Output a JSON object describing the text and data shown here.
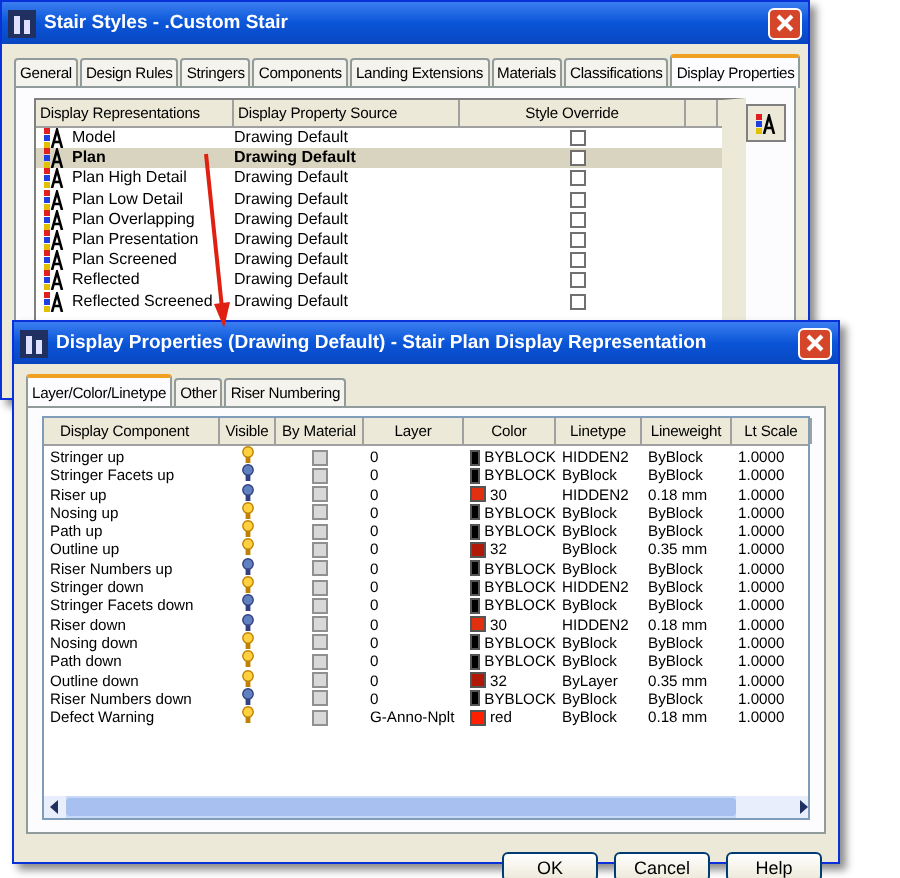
{
  "back_window": {
    "title": "Stair Styles - .Custom Stair",
    "tabs": [
      {
        "label": "General",
        "selected": false
      },
      {
        "label": "Design Rules",
        "selected": false
      },
      {
        "label": "Stringers",
        "selected": false
      },
      {
        "label": "Components",
        "selected": false
      },
      {
        "label": "Landing Extensions",
        "selected": false
      },
      {
        "label": "Materials",
        "selected": false
      },
      {
        "label": "Classifications",
        "selected": false
      },
      {
        "label": "Display Properties",
        "selected": true
      }
    ],
    "columns": [
      "Display Representations",
      "Display Property Source",
      "Style Override"
    ],
    "rows": [
      {
        "name": "Model",
        "source": "Drawing Default",
        "override": false,
        "selected": false
      },
      {
        "name": "Plan",
        "source": "Drawing Default",
        "override": false,
        "selected": true
      },
      {
        "name": "Plan High Detail",
        "source": "Drawing Default",
        "override": false,
        "selected": false
      },
      {
        "name": "Plan Low Detail",
        "source": "Drawing Default",
        "override": false,
        "selected": false
      },
      {
        "name": "Plan Overlapping",
        "source": "Drawing Default",
        "override": false,
        "selected": false
      },
      {
        "name": "Plan Presentation",
        "source": "Drawing Default",
        "override": false,
        "selected": false
      },
      {
        "name": "Plan Screened",
        "source": "Drawing Default",
        "override": false,
        "selected": false
      },
      {
        "name": "Reflected",
        "source": "Drawing Default",
        "override": false,
        "selected": false
      },
      {
        "name": "Reflected Screened",
        "source": "Drawing Default",
        "override": false,
        "selected": false
      }
    ]
  },
  "dialog": {
    "title": "Display Properties (Drawing Default) - Stair Plan Display Representation",
    "tabs": [
      {
        "label": "Layer/Color/Linetype",
        "selected": true
      },
      {
        "label": "Other",
        "selected": false
      },
      {
        "label": "Riser Numbering",
        "selected": false
      }
    ],
    "columns": [
      "Display Component",
      "Visible",
      "By Material",
      "Layer",
      "Color",
      "Linetype",
      "Lineweight",
      "Lt Scale"
    ],
    "rows": [
      {
        "component": "Stringer up",
        "visible": true,
        "by_material": false,
        "layer": "0",
        "color_name": "BYBLOCK",
        "color": "#000000",
        "linetype": "HIDDEN2",
        "lineweight": "ByBlock",
        "lt_scale": "1.0000"
      },
      {
        "component": "Stringer Facets up",
        "visible": false,
        "by_material": false,
        "layer": "0",
        "color_name": "BYBLOCK",
        "color": "#000000",
        "linetype": "ByBlock",
        "lineweight": "ByBlock",
        "lt_scale": "1.0000"
      },
      {
        "component": "Riser up",
        "visible": false,
        "by_material": false,
        "layer": "0",
        "color_name": "30",
        "color": "#e03010",
        "linetype": "HIDDEN2",
        "lineweight": "0.18 mm",
        "lt_scale": "1.0000"
      },
      {
        "component": "Nosing up",
        "visible": true,
        "by_material": false,
        "layer": "0",
        "color_name": "BYBLOCK",
        "color": "#000000",
        "linetype": "ByBlock",
        "lineweight": "ByBlock",
        "lt_scale": "1.0000"
      },
      {
        "component": "Path up",
        "visible": true,
        "by_material": false,
        "layer": "0",
        "color_name": "BYBLOCK",
        "color": "#000000",
        "linetype": "ByBlock",
        "lineweight": "ByBlock",
        "lt_scale": "1.0000"
      },
      {
        "component": "Outline up",
        "visible": true,
        "by_material": false,
        "layer": "0",
        "color_name": "32",
        "color": "#b01808",
        "linetype": "ByBlock",
        "lineweight": "0.35 mm",
        "lt_scale": "1.0000"
      },
      {
        "component": "Riser Numbers up",
        "visible": false,
        "by_material": false,
        "layer": "0",
        "color_name": "BYBLOCK",
        "color": "#000000",
        "linetype": "ByBlock",
        "lineweight": "ByBlock",
        "lt_scale": "1.0000"
      },
      {
        "component": "Stringer down",
        "visible": true,
        "by_material": false,
        "layer": "0",
        "color_name": "BYBLOCK",
        "color": "#000000",
        "linetype": "HIDDEN2",
        "lineweight": "ByBlock",
        "lt_scale": "1.0000"
      },
      {
        "component": "Stringer Facets down",
        "visible": false,
        "by_material": false,
        "layer": "0",
        "color_name": "BYBLOCK",
        "color": "#000000",
        "linetype": "ByBlock",
        "lineweight": "ByBlock",
        "lt_scale": "1.0000"
      },
      {
        "component": "Riser down",
        "visible": false,
        "by_material": false,
        "layer": "0",
        "color_name": "30",
        "color": "#e03010",
        "linetype": "HIDDEN2",
        "lineweight": "0.18 mm",
        "lt_scale": "1.0000"
      },
      {
        "component": "Nosing down",
        "visible": true,
        "by_material": false,
        "layer": "0",
        "color_name": "BYBLOCK",
        "color": "#000000",
        "linetype": "ByBlock",
        "lineweight": "ByBlock",
        "lt_scale": "1.0000"
      },
      {
        "component": "Path down",
        "visible": true,
        "by_material": false,
        "layer": "0",
        "color_name": "BYBLOCK",
        "color": "#000000",
        "linetype": "ByBlock",
        "lineweight": "ByBlock",
        "lt_scale": "1.0000"
      },
      {
        "component": "Outline down",
        "visible": true,
        "by_material": false,
        "layer": "0",
        "color_name": "32",
        "color": "#b01808",
        "linetype": "ByLayer",
        "lineweight": "0.35 mm",
        "lt_scale": "1.0000"
      },
      {
        "component": "Riser Numbers down",
        "visible": false,
        "by_material": false,
        "layer": "0",
        "color_name": "BYBLOCK",
        "color": "#000000",
        "linetype": "ByBlock",
        "lineweight": "ByBlock",
        "lt_scale": "1.0000"
      },
      {
        "component": "Defect Warning",
        "visible": true,
        "by_material": false,
        "layer": "G-Anno-Nplt",
        "color_name": "red",
        "color": "#ff2000",
        "linetype": "ByBlock",
        "lineweight": "0.18 mm",
        "lt_scale": "1.0000"
      }
    ],
    "buttons": [
      "OK",
      "Cancel",
      "Help"
    ]
  }
}
